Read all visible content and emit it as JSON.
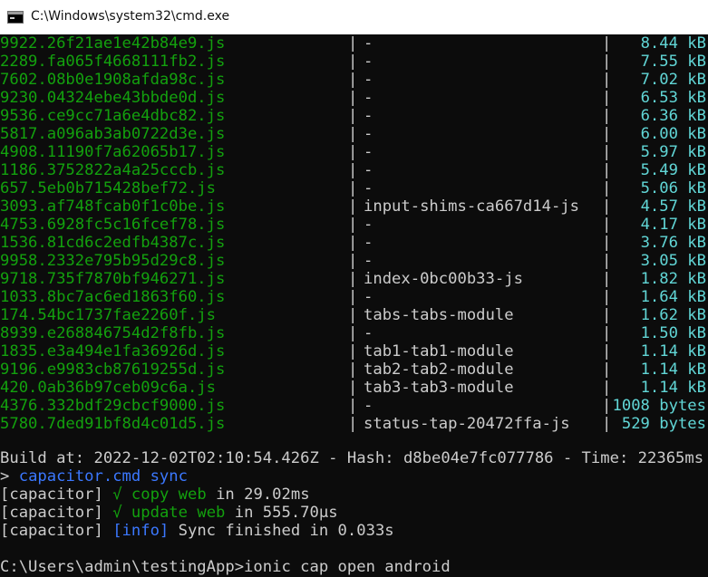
{
  "window": {
    "title": "C:\\Windows\\system32\\cmd.exe"
  },
  "table": {
    "rows": [
      {
        "file": "9922.26f21ae1e42b84e9.js",
        "name": "-",
        "size": "8.44 kB"
      },
      {
        "file": "2289.fa065f4668111fb2.js",
        "name": "-",
        "size": "7.55 kB"
      },
      {
        "file": "7602.08b0e1908afda98c.js",
        "name": "-",
        "size": "7.02 kB"
      },
      {
        "file": "9230.04324ebe43bbde0d.js",
        "name": "-",
        "size": "6.53 kB"
      },
      {
        "file": "9536.ce9cc71a6e4dbc82.js",
        "name": "-",
        "size": "6.36 kB"
      },
      {
        "file": "5817.a096ab3ab0722d3e.js",
        "name": "-",
        "size": "6.00 kB"
      },
      {
        "file": "4908.11190f7a62065b17.js",
        "name": "-",
        "size": "5.97 kB"
      },
      {
        "file": "1186.3752822a4a25cccb.js",
        "name": "-",
        "size": "5.49 kB"
      },
      {
        "file": "657.5eb0b715428bef72.js",
        "name": "-",
        "size": "5.06 kB"
      },
      {
        "file": "3093.af748fcab0f1c0be.js",
        "name": "input-shims-ca667d14-js",
        "size": "4.57 kB"
      },
      {
        "file": "4753.6928fc5c16fcef78.js",
        "name": "-",
        "size": "4.17 kB"
      },
      {
        "file": "1536.81cd6c2edfb4387c.js",
        "name": "-",
        "size": "3.76 kB"
      },
      {
        "file": "9958.2332e795b95d29c8.js",
        "name": "-",
        "size": "3.05 kB"
      },
      {
        "file": "9718.735f7870bf946271.js",
        "name": "index-0bc00b33-js",
        "size": "1.82 kB"
      },
      {
        "file": "1033.8bc7ac6ed1863f60.js",
        "name": "-",
        "size": "1.64 kB"
      },
      {
        "file": "174.54bc1737fae2260f.js",
        "name": "tabs-tabs-module",
        "size": "1.62 kB"
      },
      {
        "file": "8939.e268846754d2f8fb.js",
        "name": "-",
        "size": "1.50 kB"
      },
      {
        "file": "1835.e3a494e1fa36926d.js",
        "name": "tab1-tab1-module",
        "size": "1.14 kB"
      },
      {
        "file": "9196.e9983cb87619255d.js",
        "name": "tab2-tab2-module",
        "size": "1.14 kB"
      },
      {
        "file": "420.0ab36b97ceb09c6a.js",
        "name": "tab3-tab3-module",
        "size": "1.14 kB"
      },
      {
        "file": "4376.332bdf29cbcf9000.js",
        "name": "-",
        "size": "1008 bytes"
      },
      {
        "file": "5780.7ded91bf8d4c01d5.js",
        "name": "status-tap-20472ffa-js",
        "size": "529 bytes"
      }
    ]
  },
  "build": {
    "line": "Build at: 2022-12-02T02:10:54.426Z - Hash: d8be04e7fc077786 - Time: 22365ms"
  },
  "sync": {
    "prompt": ">",
    "command": "capacitor.cmd sync",
    "lines": [
      {
        "prefix": "[capacitor]",
        "check": "√",
        "task": "copy web",
        "rest": "in 29.02ms"
      },
      {
        "prefix": "[capacitor]",
        "check": "√",
        "task": "update web",
        "rest": "in 555.70μs"
      }
    ],
    "info_prefix": "[capacitor]",
    "info_tag": "[info]",
    "info_text": "Sync finished in 0.033s"
  },
  "prompt": {
    "path": "C:\\Users\\admin\\testingApp>",
    "command": "ionic cap open android"
  },
  "colors": {
    "background": "#0c0c0c",
    "file_green": "#13a10e",
    "size_cyan": "#61d6d6",
    "text_gray": "#cccccc",
    "command_blue": "#3b78ff"
  },
  "icons": {
    "app_icon": "cmd-console-icon"
  }
}
